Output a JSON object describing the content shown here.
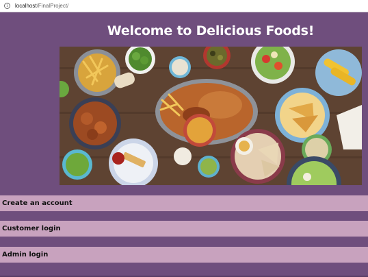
{
  "browser": {
    "url_host": "localhost",
    "url_path": "/FinalProject/"
  },
  "page": {
    "heading": "Welcome to Delicious Foods!"
  },
  "menu": [
    {
      "label": "Create an account"
    },
    {
      "label": "Customer login"
    },
    {
      "label": "Admin login"
    }
  ],
  "colors": {
    "page_background": "#6f4e7d",
    "button_background": "#c8a2be",
    "heading_text": "#ffffff"
  }
}
